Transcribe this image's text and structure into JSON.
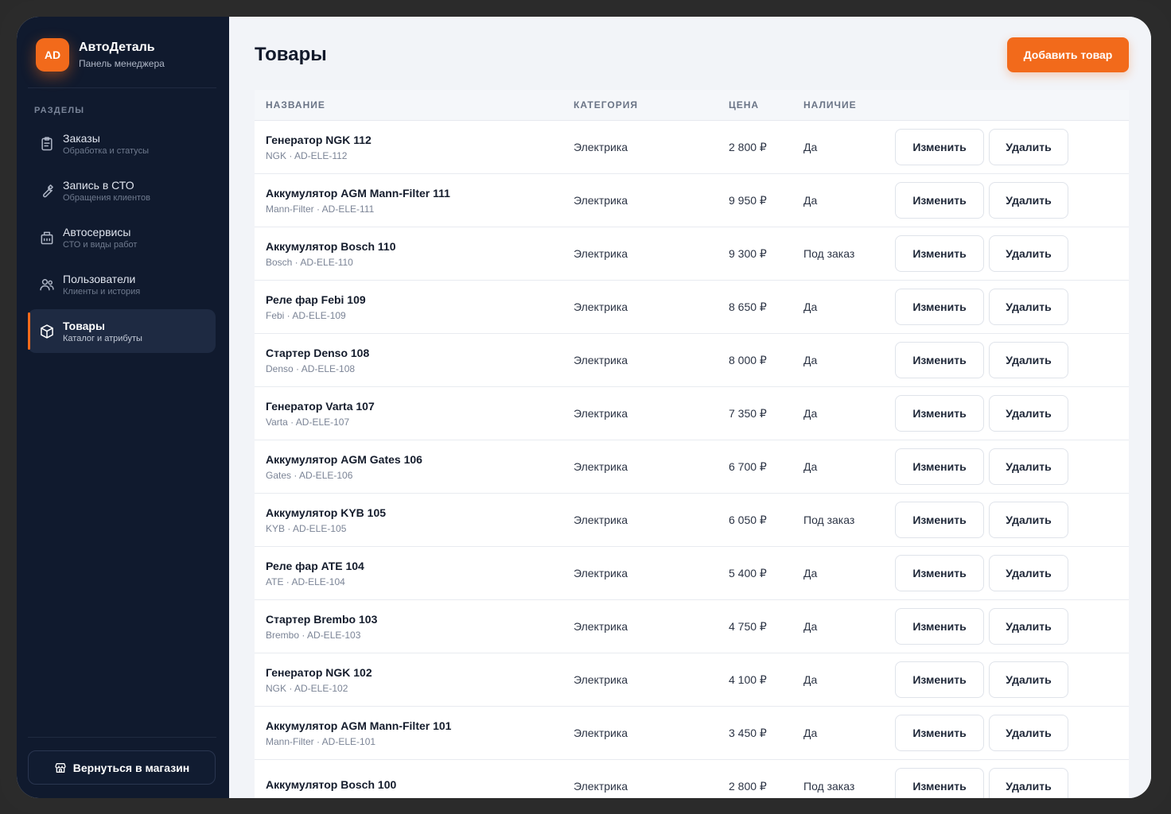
{
  "brand": {
    "logo": "AD",
    "name": "АвтоДеталь",
    "subtitle": "Панель менеджера"
  },
  "sidebar": {
    "section_label": "РАЗДЕЛЫ",
    "items": [
      {
        "title": "Заказы",
        "subtitle": "Обработка и статусы",
        "icon": "clipboard-icon",
        "active": false
      },
      {
        "title": "Запись в СТО",
        "subtitle": "Обращения клиентов",
        "icon": "wrench-icon",
        "active": false
      },
      {
        "title": "Автосервисы",
        "subtitle": "СТО и виды работ",
        "icon": "building-icon",
        "active": false
      },
      {
        "title": "Пользователи",
        "subtitle": "Клиенты и история",
        "icon": "users-icon",
        "active": false
      },
      {
        "title": "Товары",
        "subtitle": "Каталог и атрибуты",
        "icon": "box-icon",
        "active": true
      }
    ],
    "back_label": "Вернуться в магазин"
  },
  "main": {
    "title": "Товары",
    "add_button": "Добавить товар",
    "columns": [
      "НАЗВАНИЕ",
      "КАТЕГОРИЯ",
      "ЦЕНА",
      "НАЛИЧИЕ"
    ],
    "edit_label": "Изменить",
    "delete_label": "Удалить",
    "rows": [
      {
        "name": "Генератор NGK 112",
        "meta": "NGK · AD-ELE-112",
        "category": "Электрика",
        "price": "2 800 ₽",
        "availability": "Да"
      },
      {
        "name": "Аккумулятор AGM Mann-Filter 111",
        "meta": "Mann-Filter · AD-ELE-111",
        "category": "Электрика",
        "price": "9 950 ₽",
        "availability": "Да"
      },
      {
        "name": "Аккумулятор Bosch 110",
        "meta": "Bosch · AD-ELE-110",
        "category": "Электрика",
        "price": "9 300 ₽",
        "availability": "Под заказ"
      },
      {
        "name": "Реле фар Febi 109",
        "meta": "Febi · AD-ELE-109",
        "category": "Электрика",
        "price": "8 650 ₽",
        "availability": "Да"
      },
      {
        "name": "Стартер Denso 108",
        "meta": "Denso · AD-ELE-108",
        "category": "Электрика",
        "price": "8 000 ₽",
        "availability": "Да"
      },
      {
        "name": "Генератор Varta 107",
        "meta": "Varta · AD-ELE-107",
        "category": "Электрика",
        "price": "7 350 ₽",
        "availability": "Да"
      },
      {
        "name": "Аккумулятор AGM Gates 106",
        "meta": "Gates · AD-ELE-106",
        "category": "Электрика",
        "price": "6 700 ₽",
        "availability": "Да"
      },
      {
        "name": "Аккумулятор KYB 105",
        "meta": "KYB · AD-ELE-105",
        "category": "Электрика",
        "price": "6 050 ₽",
        "availability": "Под заказ"
      },
      {
        "name": "Реле фар ATE 104",
        "meta": "ATE · AD-ELE-104",
        "category": "Электрика",
        "price": "5 400 ₽",
        "availability": "Да"
      },
      {
        "name": "Стартер Brembo 103",
        "meta": "Brembo · AD-ELE-103",
        "category": "Электрика",
        "price": "4 750 ₽",
        "availability": "Да"
      },
      {
        "name": "Генератор NGK 102",
        "meta": "NGK · AD-ELE-102",
        "category": "Электрика",
        "price": "4 100 ₽",
        "availability": "Да"
      },
      {
        "name": "Аккумулятор AGM Mann-Filter 101",
        "meta": "Mann-Filter · AD-ELE-101",
        "category": "Электрика",
        "price": "3 450 ₽",
        "availability": "Да"
      },
      {
        "name": "Аккумулятор Bosch 100",
        "meta": "",
        "category": "Электрика",
        "price": "2 800 ₽",
        "availability": "Под заказ"
      }
    ]
  },
  "colors": {
    "accent": "#f26a1b",
    "sidebar_bg": "#101a2e",
    "page_bg": "#f2f4f8"
  }
}
